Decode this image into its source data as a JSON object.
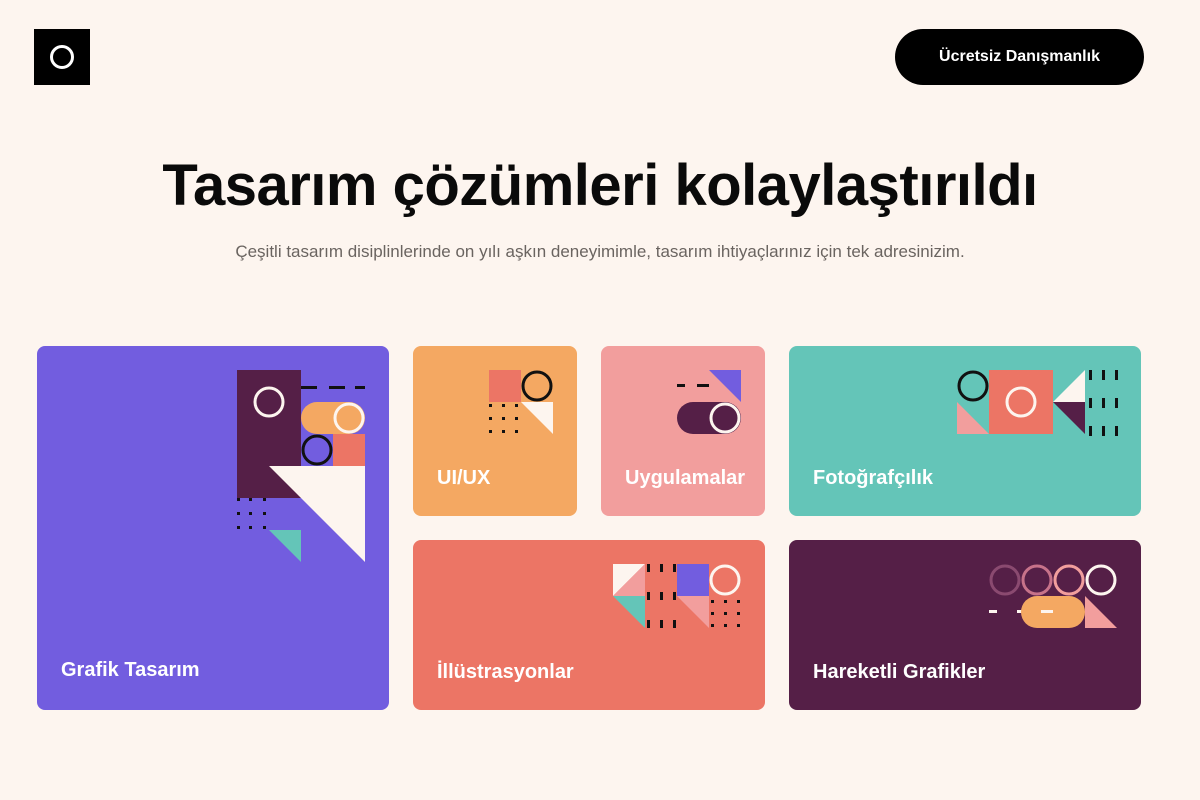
{
  "header": {
    "logo_icon": "ring-logo-icon",
    "cta_label": "Ücretsiz Danışmanlık"
  },
  "hero": {
    "title": "Tasarım çözümleri kolaylaştırıldı",
    "subtitle": "Çeşitli tasarım disiplinlerinde on yılı aşkın deneyimimle, tasarım ihtiyaçlarınız için tek adresinizim."
  },
  "services": [
    {
      "label": "Grafik Tasarım",
      "color": "#725ddf"
    },
    {
      "label": "UI/UX",
      "color": "#f4a862"
    },
    {
      "label": "Uygulamalar",
      "color": "#f29e9d"
    },
    {
      "label": "Fotoğrafçılık",
      "color": "#64c5b8"
    },
    {
      "label": "İllüstrasyonlar",
      "color": "#ec7565"
    },
    {
      "label": "Hareketli Grafikler",
      "color": "#551f47"
    }
  ],
  "palette": {
    "background": "#fdf5ef",
    "purple": "#725ddf",
    "orange": "#f4a862",
    "pink": "#f29e9d",
    "teal": "#64c5b8",
    "coral": "#ec7565",
    "plum": "#551f47",
    "cream": "#fdf5ef"
  }
}
